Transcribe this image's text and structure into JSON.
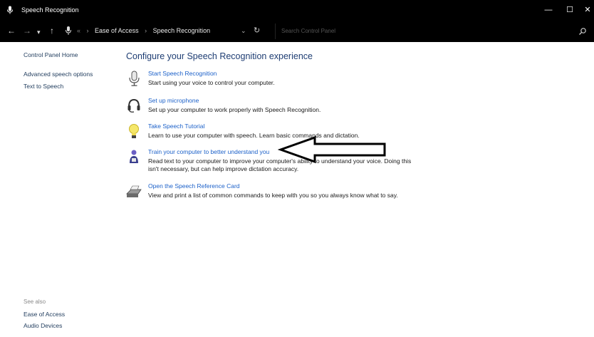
{
  "window": {
    "title": "Speech Recognition",
    "minimize_glyph": "—",
    "maximize_glyph": "☐",
    "close_glyph": "✕"
  },
  "address_bar": {
    "back_glyph": "←",
    "forward_glyph": "→",
    "recent_glyph": "▾",
    "up_glyph": "↑",
    "crumb_root_glyph": "«",
    "breadcrumbs": [
      "Ease of Access",
      "Speech Recognition"
    ],
    "separator": "›",
    "chevron_glyph": "⌄",
    "refresh_glyph": "↻",
    "search_placeholder": "Search Control Panel"
  },
  "left_pane": {
    "home": "Control Panel Home",
    "links": [
      "Advanced speech options",
      "Text to Speech"
    ],
    "see_also_label": "See also",
    "see_also_links": [
      "Ease of Access",
      "Audio Devices"
    ]
  },
  "main": {
    "heading": "Configure your Speech Recognition experience",
    "tasks": [
      {
        "icon": "microphone-icon",
        "link": "Start Speech Recognition",
        "desc": [
          "Start using your voice to control your computer."
        ]
      },
      {
        "icon": "headset-icon",
        "link": "Set up microphone",
        "desc": [
          "Set up your computer to work properly with Speech Recognition."
        ]
      },
      {
        "icon": "lightbulb-icon",
        "link": "Take Speech Tutorial",
        "desc": [
          "Learn to use your computer with speech.  Learn basic commands and dictation."
        ]
      },
      {
        "icon": "person-training-icon",
        "link": "Train your computer to better understand you",
        "desc": [
          "Read text to your computer to improve your computer's ability to understand your voice.  Doing this",
          "isn't necessary, but can help improve dictation accuracy."
        ]
      },
      {
        "icon": "printer-icon",
        "link": "Open the Speech Reference Card",
        "desc": [
          "View and print a list of common commands to keep with you so you always know what to say."
        ]
      }
    ]
  },
  "annotation": {
    "shape": "arrow-pointing-left",
    "color": "#000000"
  },
  "colors": {
    "link": "#1c61c9",
    "heading": "#1e3d73",
    "titlebar": "#000000"
  }
}
